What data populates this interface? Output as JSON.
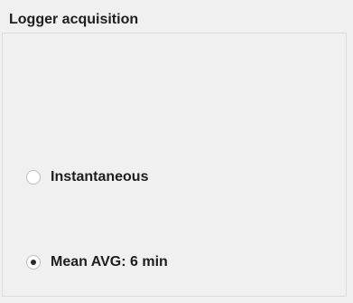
{
  "group": {
    "title": "Logger acquisition"
  },
  "options": [
    {
      "label": "Instantaneous",
      "checked": false
    },
    {
      "label": "Mean AVG: 6 min",
      "checked": true
    }
  ]
}
